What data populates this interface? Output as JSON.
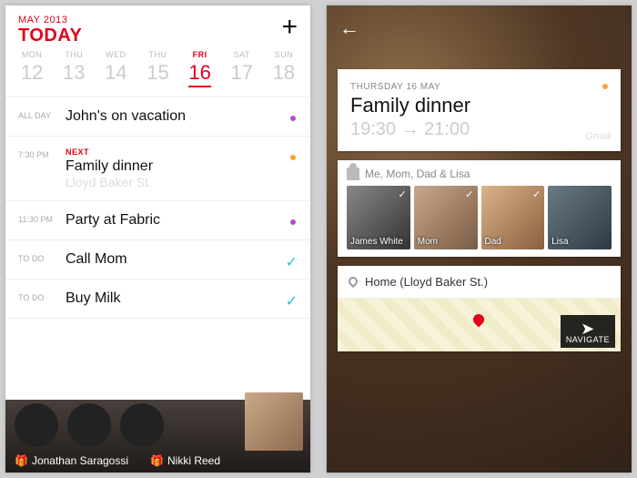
{
  "left": {
    "month_line": "MAY 2013",
    "today_label": "TODAY",
    "days": [
      {
        "dow": "MON",
        "num": "12"
      },
      {
        "dow": "THU",
        "num": "13"
      },
      {
        "dow": "WED",
        "num": "14"
      },
      {
        "dow": "THU",
        "num": "15"
      },
      {
        "dow": "FRI",
        "num": "16",
        "selected": true
      },
      {
        "dow": "SAT",
        "num": "17"
      },
      {
        "dow": "SUN",
        "num": "18"
      }
    ],
    "events": [
      {
        "time": "ALL DAY",
        "title": "John's on vacation",
        "dot": "purple"
      },
      {
        "time": "7:30 PM",
        "next": "NEXT",
        "title": "Family dinner",
        "sub": "Lloyd Baker St.",
        "dot": "orange"
      },
      {
        "time": "11:30 PM",
        "title": "Party at Fabric",
        "dot": "purple"
      }
    ],
    "todos": [
      {
        "label": "TO DO",
        "title": "Call Mom"
      },
      {
        "label": "TO DO",
        "title": "Buy Milk"
      }
    ],
    "birthdays": [
      "Jonathan Saragossi",
      "Nikki Reed"
    ]
  },
  "right": {
    "date_line": "THURSDAY 16 MAY",
    "title": "Family dinner",
    "time": "19:30 → 21:00",
    "source": "Gmail",
    "attendees_line": "Me, Mom, Dad & Lisa",
    "attendees": [
      {
        "name": "James White",
        "checked": true
      },
      {
        "name": "Mom",
        "checked": true
      },
      {
        "name": "Dad",
        "checked": true
      },
      {
        "name": "Lisa",
        "checked": false
      }
    ],
    "location": "Home (Lloyd Baker St.)",
    "navigate_label": "NAVIGATE"
  }
}
